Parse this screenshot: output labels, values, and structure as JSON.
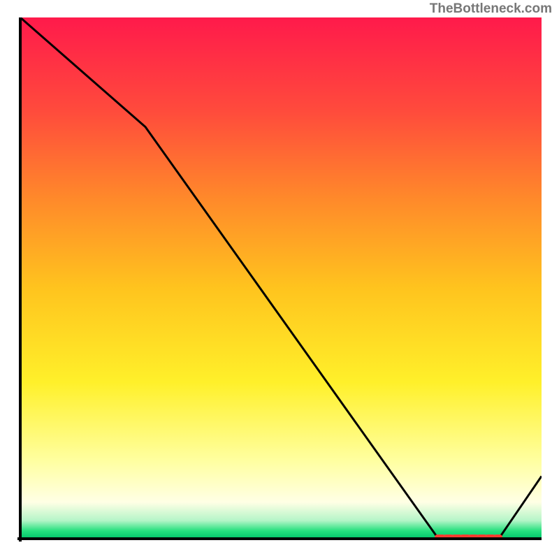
{
  "attribution": "TheBottleneck.com",
  "chart_data": {
    "type": "line",
    "title": "",
    "xlabel": "",
    "ylabel": "",
    "background": "vertical-gradient",
    "gradient_stops": [
      {
        "pos": 0.0,
        "color": "#ff1a4b"
      },
      {
        "pos": 0.18,
        "color": "#ff4b3c"
      },
      {
        "pos": 0.35,
        "color": "#ff8a2a"
      },
      {
        "pos": 0.52,
        "color": "#ffc41e"
      },
      {
        "pos": 0.7,
        "color": "#fff02a"
      },
      {
        "pos": 0.85,
        "color": "#ffffa0"
      },
      {
        "pos": 0.93,
        "color": "#ffffe5"
      },
      {
        "pos": 0.965,
        "color": "#b5f5c8"
      },
      {
        "pos": 0.985,
        "color": "#25e07e"
      },
      {
        "pos": 1.0,
        "color": "#00c46a"
      }
    ],
    "series": [
      {
        "name": "bottleneck-curve",
        "color": "#000000",
        "x": [
          0.0,
          0.24,
          0.8,
          0.87,
          0.92,
          1.0
        ],
        "y": [
          1.0,
          0.79,
          0.003,
          0.0,
          0.003,
          0.12
        ]
      }
    ],
    "marker": {
      "name": "highlight-segment",
      "color": "#ff3b30",
      "x_start": 0.8,
      "x_end": 0.92,
      "y": 0.003,
      "thickness_frac": 0.01
    },
    "xlim": [
      0,
      1
    ],
    "ylim": [
      0,
      1
    ]
  }
}
